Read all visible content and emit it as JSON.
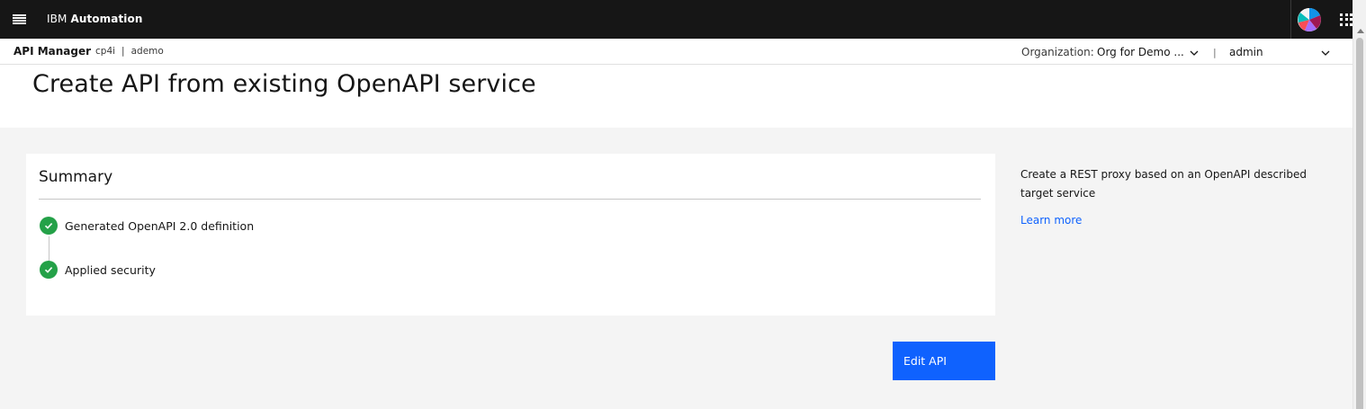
{
  "shell": {
    "brand_prefix": "IBM",
    "brand_name": "Automation"
  },
  "subheader": {
    "app_name": "API Manager",
    "context_1": "cp4i",
    "context_separator": "|",
    "context_2": "ademo",
    "org_label": "Organization:",
    "org_value": "Org for Demo ...",
    "divider": "|",
    "user_value": "admin"
  },
  "page": {
    "title": "Create API from existing OpenAPI service"
  },
  "summary": {
    "title": "Summary",
    "steps": [
      {
        "label": "Generated OpenAPI 2.0 definition",
        "status": "complete"
      },
      {
        "label": "Applied security",
        "status": "complete"
      }
    ]
  },
  "sidebar": {
    "description": "Create a REST proxy based on an OpenAPI described target service",
    "learn_more": "Learn more"
  },
  "actions": {
    "edit_api": "Edit API"
  },
  "colors": {
    "shell_bg": "#161616",
    "primary": "#0f62fe",
    "success": "#24a148",
    "content_bg": "#f4f4f4",
    "link": "#0f62fe"
  },
  "icons": {
    "menu": "hamburger-menu-icon",
    "avatar": "user-avatar-icon",
    "apps": "app-switcher-icon",
    "org_dropdown": "chevron-down-icon",
    "user_dropdown": "chevron-down-icon",
    "step": "checkmark-filled-icon"
  }
}
